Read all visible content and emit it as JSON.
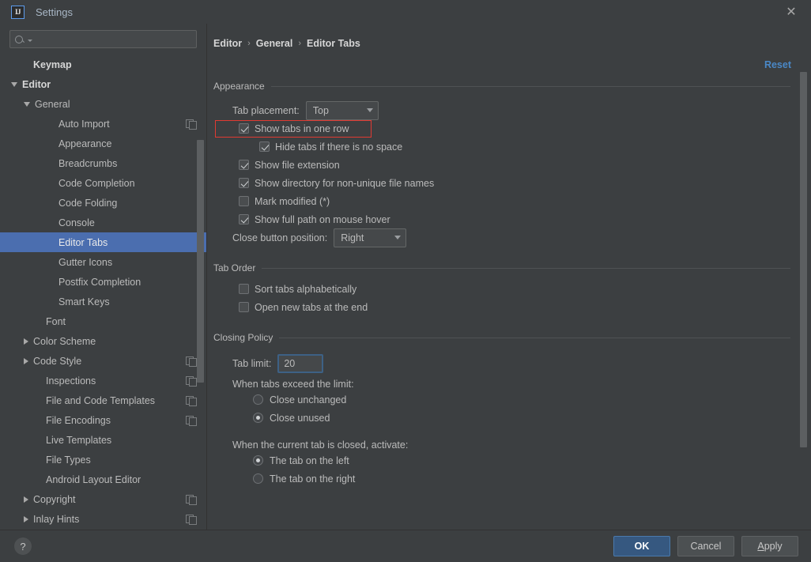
{
  "window": {
    "title": "Settings",
    "logo_text": "IJ",
    "close_icon": "✕"
  },
  "sidebar": {
    "search": {
      "value": "",
      "placeholder": ""
    },
    "items": [
      {
        "label": "Keymap",
        "indent": 1,
        "arrow": "none",
        "bright": true,
        "copy": false,
        "selected": false
      },
      {
        "label": "Editor",
        "indent": 0,
        "arrow": "expanded",
        "bright": true,
        "copy": false,
        "selected": false
      },
      {
        "label": "General",
        "indent": 1,
        "arrow": "expanded",
        "bright": false,
        "copy": false,
        "selected": false
      },
      {
        "label": "Auto Import",
        "indent": 3,
        "arrow": "none",
        "bright": false,
        "copy": true,
        "selected": false
      },
      {
        "label": "Appearance",
        "indent": 3,
        "arrow": "none",
        "bright": false,
        "copy": false,
        "selected": false
      },
      {
        "label": "Breadcrumbs",
        "indent": 3,
        "arrow": "none",
        "bright": false,
        "copy": false,
        "selected": false
      },
      {
        "label": "Code Completion",
        "indent": 3,
        "arrow": "none",
        "bright": false,
        "copy": false,
        "selected": false
      },
      {
        "label": "Code Folding",
        "indent": 3,
        "arrow": "none",
        "bright": false,
        "copy": false,
        "selected": false
      },
      {
        "label": "Console",
        "indent": 3,
        "arrow": "none",
        "bright": false,
        "copy": false,
        "selected": false
      },
      {
        "label": "Editor Tabs",
        "indent": 3,
        "arrow": "none",
        "bright": false,
        "copy": false,
        "selected": true
      },
      {
        "label": "Gutter Icons",
        "indent": 3,
        "arrow": "none",
        "bright": false,
        "copy": false,
        "selected": false
      },
      {
        "label": "Postfix Completion",
        "indent": 3,
        "arrow": "none",
        "bright": false,
        "copy": false,
        "selected": false
      },
      {
        "label": "Smart Keys",
        "indent": 3,
        "arrow": "none",
        "bright": false,
        "copy": false,
        "selected": false
      },
      {
        "label": "Font",
        "indent": 2,
        "arrow": "none",
        "bright": false,
        "copy": false,
        "selected": false
      },
      {
        "label": "Color Scheme",
        "indent": 1,
        "arrow": "collapsed",
        "bright": false,
        "copy": false,
        "selected": false
      },
      {
        "label": "Code Style",
        "indent": 1,
        "arrow": "collapsed",
        "bright": false,
        "copy": true,
        "selected": false
      },
      {
        "label": "Inspections",
        "indent": 2,
        "arrow": "none",
        "bright": false,
        "copy": true,
        "selected": false
      },
      {
        "label": "File and Code Templates",
        "indent": 2,
        "arrow": "none",
        "bright": false,
        "copy": true,
        "selected": false
      },
      {
        "label": "File Encodings",
        "indent": 2,
        "arrow": "none",
        "bright": false,
        "copy": true,
        "selected": false
      },
      {
        "label": "Live Templates",
        "indent": 2,
        "arrow": "none",
        "bright": false,
        "copy": false,
        "selected": false
      },
      {
        "label": "File Types",
        "indent": 2,
        "arrow": "none",
        "bright": false,
        "copy": false,
        "selected": false
      },
      {
        "label": "Android Layout Editor",
        "indent": 2,
        "arrow": "none",
        "bright": false,
        "copy": false,
        "selected": false
      },
      {
        "label": "Copyright",
        "indent": 1,
        "arrow": "collapsed",
        "bright": false,
        "copy": true,
        "selected": false
      },
      {
        "label": "Inlay Hints",
        "indent": 1,
        "arrow": "collapsed",
        "bright": false,
        "copy": true,
        "selected": false
      }
    ],
    "scrollbar": {
      "top_pct": 23,
      "height_pct": 48
    }
  },
  "content": {
    "breadcrumb": [
      "Editor",
      "General",
      "Editor Tabs"
    ],
    "breadcrumb_separator": "›",
    "reset_label": "Reset",
    "scrollbar": {
      "top_pct": 5,
      "height_pct": 78
    },
    "sections": {
      "appearance": {
        "title": "Appearance",
        "tab_placement_label": "Tab placement:",
        "tab_placement_value": "Top",
        "checkboxes": [
          {
            "label": "Show tabs in one row",
            "checked": true,
            "sub": false,
            "highlighted": true
          },
          {
            "label": "Hide tabs if there is no space",
            "checked": true,
            "sub": true,
            "highlighted": false
          },
          {
            "label": "Show file extension",
            "checked": true,
            "sub": false,
            "highlighted": false
          },
          {
            "label": "Show directory for non-unique file names",
            "checked": true,
            "sub": false,
            "highlighted": false
          },
          {
            "label": "Mark modified (*)",
            "checked": false,
            "sub": false,
            "highlighted": false
          },
          {
            "label": "Show full path on mouse hover",
            "checked": true,
            "sub": false,
            "highlighted": false
          }
        ],
        "close_button_label": "Close button position:",
        "close_button_value": "Right"
      },
      "tab_order": {
        "title": "Tab Order",
        "checkboxes": [
          {
            "label": "Sort tabs alphabetically",
            "checked": false
          },
          {
            "label": "Open new tabs at the end",
            "checked": false
          }
        ]
      },
      "closing_policy": {
        "title": "Closing Policy",
        "tab_limit_label": "Tab limit:",
        "tab_limit_value": "20",
        "exceed_label": "When tabs exceed the limit:",
        "exceed_options": [
          {
            "label": "Close unchanged",
            "selected": false
          },
          {
            "label": "Close unused",
            "selected": true
          }
        ],
        "activate_label": "When the current tab is closed, activate:",
        "activate_options": [
          {
            "label": "The tab on the left",
            "selected": true
          },
          {
            "label": "The tab on the right",
            "selected": false
          }
        ]
      }
    }
  },
  "footer": {
    "help_label": "?",
    "buttons": [
      {
        "label": "OK",
        "primary": true,
        "mnemonic": ""
      },
      {
        "label": "Cancel",
        "primary": false,
        "mnemonic": ""
      },
      {
        "label": "Apply",
        "primary": false,
        "mnemonic": "A"
      }
    ]
  },
  "colors": {
    "window_bg": "#3c3f41",
    "selection": "#4b6eaf",
    "accent_link": "#4a88c7",
    "primary_button": "#365880",
    "highlight_outline": "#e03a32",
    "focus_border": "#3d6185"
  }
}
